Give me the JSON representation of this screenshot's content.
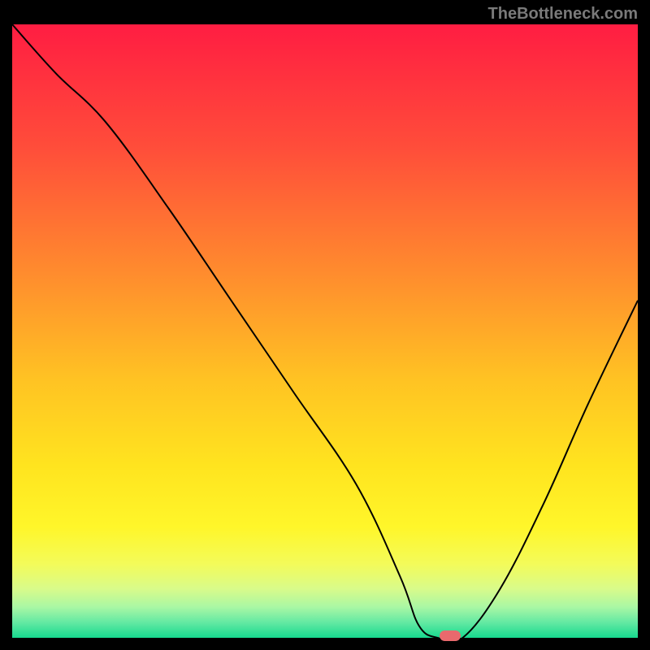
{
  "watermark": "TheBottleneck.com",
  "chart_data": {
    "type": "line",
    "title": "",
    "xlabel": "",
    "ylabel": "",
    "xlim": [
      0,
      100
    ],
    "ylim": [
      0,
      100
    ],
    "series": [
      {
        "name": "bottleneck-curve",
        "x": [
          0,
          7,
          15,
          25,
          35,
          45,
          55,
          62,
          65,
          68,
          72,
          78,
          85,
          92,
          100
        ],
        "values": [
          100,
          92,
          84,
          70,
          55,
          40,
          25,
          10,
          2,
          0,
          0,
          8,
          22,
          38,
          55
        ]
      }
    ],
    "marker": {
      "x": 70,
      "y": 0,
      "color": "#e9696d"
    },
    "gradient_stops": [
      {
        "pos": 0.0,
        "color": "#ff1d42"
      },
      {
        "pos": 0.2,
        "color": "#ff4d3a"
      },
      {
        "pos": 0.4,
        "color": "#ff8a2e"
      },
      {
        "pos": 0.58,
        "color": "#ffc323"
      },
      {
        "pos": 0.72,
        "color": "#ffe41f"
      },
      {
        "pos": 0.82,
        "color": "#fff62a"
      },
      {
        "pos": 0.88,
        "color": "#f3fb5a"
      },
      {
        "pos": 0.92,
        "color": "#d9fb8a"
      },
      {
        "pos": 0.95,
        "color": "#a9f7a4"
      },
      {
        "pos": 0.975,
        "color": "#63e9a3"
      },
      {
        "pos": 1.0,
        "color": "#17d98e"
      }
    ]
  }
}
